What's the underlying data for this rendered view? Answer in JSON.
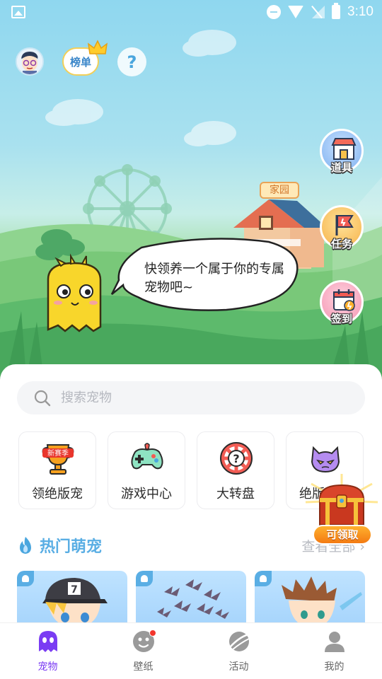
{
  "status_bar": {
    "time": "3:10"
  },
  "top_bar": {
    "rank_label": "榜单",
    "help_label": "?"
  },
  "side_buttons": [
    {
      "label": "道具",
      "icon": "shop-icon"
    },
    {
      "label": "任务",
      "icon": "flag-icon"
    },
    {
      "label": "签到",
      "icon": "calendar-icon"
    }
  ],
  "scene": {
    "home_sign": "家园",
    "speech": "快领养一个属于你的专属宠物吧~"
  },
  "search": {
    "placeholder": "搜索宠物"
  },
  "categories": [
    {
      "label": "领绝版宠",
      "badge": "新赛季",
      "icon": "trophy-icon"
    },
    {
      "label": "游戏中心",
      "icon": "gamepad-icon"
    },
    {
      "label": "大转盘",
      "icon": "lucky-wheel-icon"
    },
    {
      "label": "绝版萌宠",
      "icon": "devil-pet-icon"
    }
  ],
  "reward": {
    "label": "可领取"
  },
  "hot_section": {
    "title": "热门萌宠",
    "view_all": "查看全部"
  },
  "bottom_nav": [
    {
      "label": "宠物",
      "active": true
    },
    {
      "label": "壁纸",
      "badge": true
    },
    {
      "label": "活动"
    },
    {
      "label": "我的"
    }
  ],
  "colors": {
    "accent": "#7a3cf3",
    "section_blue": "#5aaee4",
    "badge_red": "#f2352c"
  }
}
